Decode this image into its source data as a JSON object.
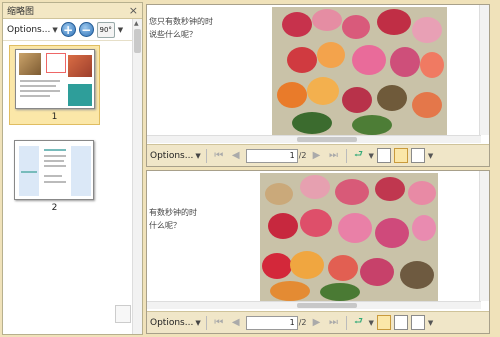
{
  "thumbnail_panel": {
    "title": "缩略图",
    "options_label": "Options...",
    "zoom_in_icon": "plus-circle-icon",
    "zoom_out_icon": "minus-circle-icon",
    "rotate_label": "90°",
    "thumbnails": [
      {
        "page_label": "1",
        "selected": true
      },
      {
        "page_label": "2",
        "selected": false
      }
    ]
  },
  "views": [
    {
      "text_lines": [
        "您只有数秒钟的时",
        "说些什么呢？"
      ],
      "options_label": "Options...",
      "page_value": "1",
      "page_total": "/2"
    },
    {
      "text_lines": [
        "有数秒钟的时",
        "什么呢？"
      ],
      "options_label": "Options...",
      "page_value": "1",
      "page_total": "/2"
    }
  ],
  "colors": {
    "accent": "#f0e2ba",
    "selected_thumb": "#fbe7a8",
    "teal_block": "#2e9e9a"
  }
}
